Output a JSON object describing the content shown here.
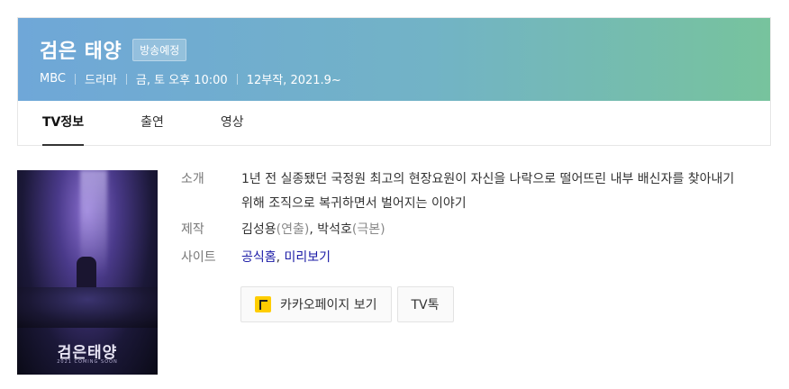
{
  "header": {
    "title": "검은 태양",
    "badge": "방송예정",
    "meta": {
      "channel": "MBC",
      "genre": "드라마",
      "schedule": "금, 토 오후 10:00",
      "episodes": "12부작, 2021.9~"
    },
    "colors": {
      "gradient_start": "#6fa7d8",
      "gradient_end": "#77c39d"
    }
  },
  "tabs": [
    {
      "label": "TV정보",
      "active": true
    },
    {
      "label": "출연",
      "active": false
    },
    {
      "label": "영상",
      "active": false
    }
  ],
  "poster": {
    "title": "검은태양",
    "subtitle": "2021 COMING SOON"
  },
  "info": {
    "synopsis_label": "소개",
    "synopsis": "1년 전 실종됐던 국정원 최고의 현장요원이 자신을 나락으로 떨어뜨린 내부 배신자를 찾아내기 위해 조직으로 복귀하면서 벌어지는 이야기",
    "staff_label": "제작",
    "staff": [
      {
        "name": "김성용",
        "role": "(연출)",
        "sep": ", "
      },
      {
        "name": "박석호",
        "role": "(극본)",
        "sep": ""
      }
    ],
    "site_label": "사이트",
    "sites": [
      {
        "label": "공식홈",
        "sep": ", "
      },
      {
        "label": "미리보기",
        "sep": ""
      }
    ]
  },
  "buttons": {
    "kakao_label": "카카오페이지 보기",
    "kakao_icon": "kakaopage-icon",
    "talk_label": "TV톡"
  }
}
